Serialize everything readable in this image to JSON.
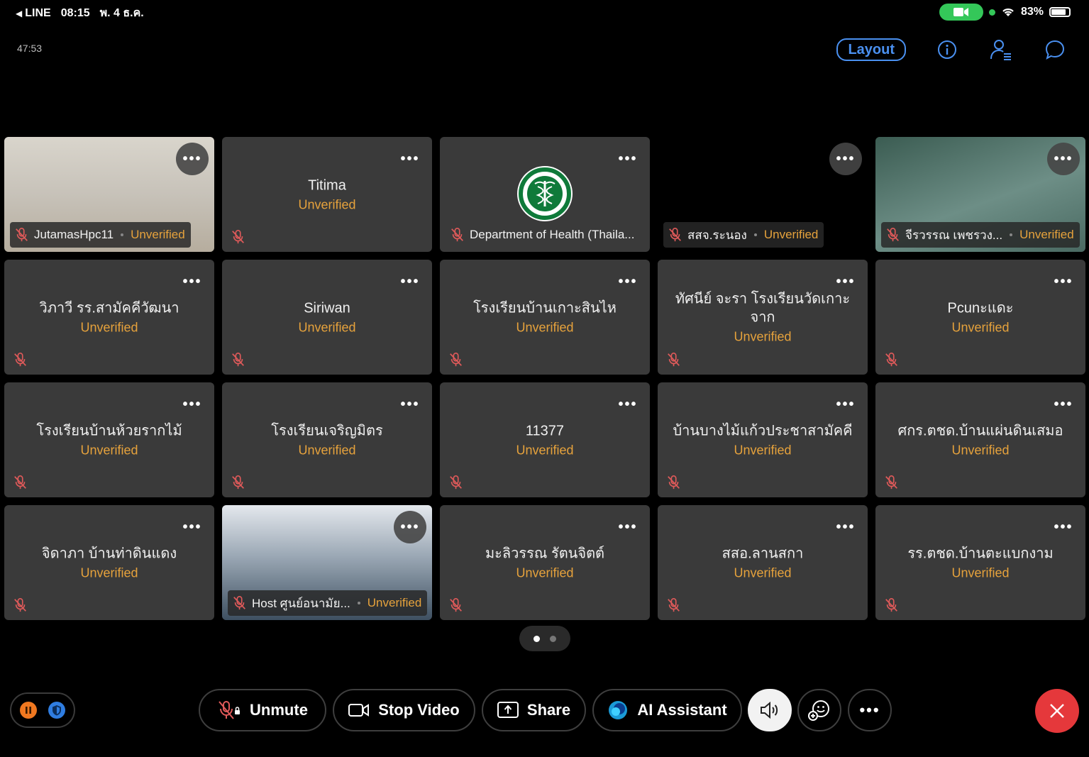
{
  "status_bar": {
    "back_app": "LINE",
    "time": "08:15",
    "date": "พ. 4 ธ.ค.",
    "battery": "83%",
    "battery_level": 0.83
  },
  "meeting": {
    "elapsed": "47:53"
  },
  "top_actions": {
    "layout_label": "Layout"
  },
  "participants": [
    {
      "name": "JutamasHpc11",
      "status": "Unverified",
      "mode": "video"
    },
    {
      "name": "Titima",
      "status": "Unverified",
      "mode": "center"
    },
    {
      "name": "Department of Health (Thaila...",
      "status": "",
      "mode": "logo"
    },
    {
      "name": "สสจ.ระนอง",
      "status": "Unverified",
      "mode": "tag-black"
    },
    {
      "name": "จีรวรรณ เพชรวง...",
      "status": "Unverified",
      "mode": "video2"
    },
    {
      "name": "วิภาวี รร.สามัคคีวัฒนา",
      "status": "Unverified",
      "mode": "center"
    },
    {
      "name": "Siriwan",
      "status": "Unverified",
      "mode": "center"
    },
    {
      "name": "โรงเรียนบ้านเกาะสินไห",
      "status": "Unverified",
      "mode": "center"
    },
    {
      "name": "ทัศนีย์ จะรา โรงเรียนวัดเกาะจาก",
      "status": "Unverified",
      "mode": "center"
    },
    {
      "name": "Pcunะแดะ",
      "status": "Unverified",
      "mode": "center"
    },
    {
      "name": "โรงเรียนบ้านห้วยรากไม้",
      "status": "Unverified",
      "mode": "center"
    },
    {
      "name": "โรงเรียนเจริญมิตร",
      "status": "Unverified",
      "mode": "center"
    },
    {
      "name": "11377",
      "status": "Unverified",
      "mode": "center"
    },
    {
      "name": "บ้านบางไม้แก้วประชาสามัคคี",
      "status": "Unverified",
      "mode": "center"
    },
    {
      "name": "ศกร.ตชด.บ้านแผ่นดินเสมอ",
      "status": "Unverified",
      "mode": "center"
    },
    {
      "name": "จิดาภา บ้านท่าดินแดง",
      "status": "Unverified",
      "mode": "center"
    },
    {
      "name": "Host ศูนย์อนามัย...",
      "status": "Unverified",
      "mode": "video3"
    },
    {
      "name": "มะลิวรรณ รัตนจิตต์",
      "status": "Unverified",
      "mode": "center"
    },
    {
      "name": "สสอ.ลานสกา",
      "status": "Unverified",
      "mode": "center"
    },
    {
      "name": "รร.ตชด.บ้านตะแบกงาม",
      "status": "Unverified",
      "mode": "center"
    }
  ],
  "pager": {
    "pages": 2,
    "current": 1
  },
  "controls": {
    "unmute": "Unmute",
    "stop_video": "Stop Video",
    "share": "Share",
    "ai_assistant": "AI Assistant"
  },
  "colors": {
    "accent": "#4a90f0",
    "unverified": "#e6a23c",
    "end": "#e5383b",
    "tile": "#3a3a3a"
  }
}
